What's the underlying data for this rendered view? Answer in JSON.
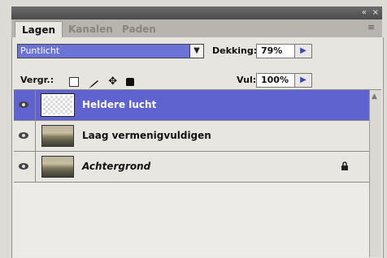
{
  "window": {
    "collapse_glyph": "«",
    "close_glyph": "×"
  },
  "tabs": [
    {
      "label": "Lagen",
      "active": true
    },
    {
      "label": "Kanalen",
      "active": false
    },
    {
      "label": "Paden",
      "active": false
    }
  ],
  "blend_mode": {
    "value": "Puntlicht"
  },
  "opacity": {
    "label": "Dekking:",
    "value": "79%"
  },
  "fill": {
    "label": "Vul:",
    "value": "100%"
  },
  "lock": {
    "label": "Vergr.:"
  },
  "layers": [
    {
      "name": "Heldere lucht",
      "selected": true,
      "visible": true,
      "locked": false,
      "thumbnail": "transparent"
    },
    {
      "name": "Laag vermenigvuldigen",
      "selected": false,
      "visible": true,
      "locked": false,
      "thumbnail": "landscape"
    },
    {
      "name": "Achtergrond",
      "selected": false,
      "visible": true,
      "locked": true,
      "thumbnail": "landscape"
    }
  ],
  "colors": {
    "selection": "#5e63cf",
    "panel": "#e6e5e0"
  }
}
